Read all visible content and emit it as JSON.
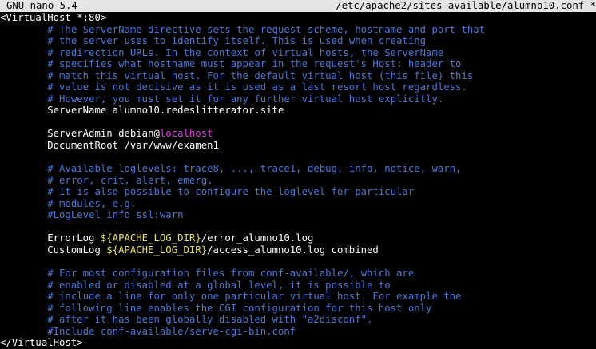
{
  "titlebar": {
    "app": "GNU nano 5.4",
    "file": "/etc/apache2/sites-available/alumno10.conf *"
  },
  "colors": {
    "background": "#000000",
    "text": "#ffffff",
    "comment": "#4a78d8",
    "hostname_highlight": "#e040e0",
    "variable_highlight": "#e8e24a",
    "titlebar_bg": "#e5e5e5"
  },
  "lines": [
    "<VirtualHost *:80>",
    "        # The ServerName directive sets the request scheme, hostname and port that",
    "        # the server uses to identify itself. This is used when creating",
    "        # redirection URLs. In the context of virtual hosts, the ServerName",
    "        # specifies what hostname must appear in the request's Host: header to",
    "        # match this virtual host. For the default virtual host (this file) this",
    "        # value is not decisive as it is used as a last resort host regardless.",
    "        # However, you must set it for any further virtual host explicitly.",
    "        ServerName alumno10.redeslitterator.site",
    "",
    "        ServerAdmin debian@",
    "localhost",
    "        DocumentRoot /var/www/examen1",
    "",
    "        # Available loglevels: trace8, ..., trace1, debug, info, notice, warn,",
    "        # error, crit, alert, emerg.",
    "        # It is also possible to configure the loglevel for particular",
    "        # modules, e.g.",
    "        #LogLevel info ssl:warn",
    "",
    "        ErrorLog ",
    "${APACHE_LOG_DIR}",
    "/error_alumno10.log",
    "        CustomLog ",
    "${APACHE_LOG_DIR}",
    "/access_alumno10.log combined",
    "",
    "        # For most configuration files from conf-available/, which are",
    "        # enabled or disabled at a global level, it is possible to",
    "        # include a line for only one particular virtual host. For example the",
    "        # following line enables the CGI configuration for this host only",
    "        # after it has been globally disabled with \"a2disconf\".",
    "        #Include conf-available/serve-cgi-bin.conf",
    "</VirtualHost>"
  ]
}
